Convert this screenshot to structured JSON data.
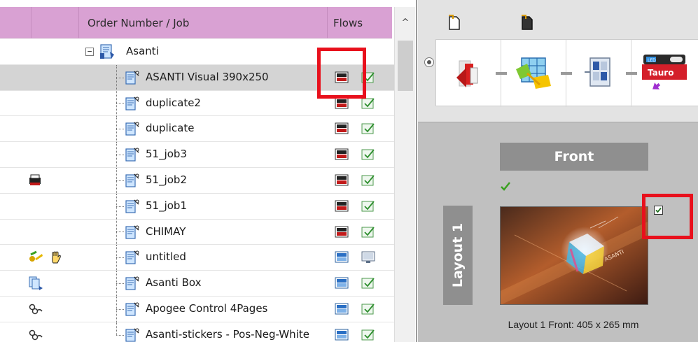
{
  "tree": {
    "columns": [
      "",
      "",
      "Order Number / Job",
      "Flows"
    ],
    "root": {
      "label": "Asanti",
      "expander": "⊟"
    },
    "rows": [
      {
        "label": "ASANTI Visual 390x250",
        "selected": true,
        "status": [],
        "flow1": "dark",
        "flow2": "check"
      },
      {
        "label": "duplicate2",
        "selected": false,
        "status": [],
        "flow1": "dark",
        "flow2": "check"
      },
      {
        "label": "duplicate",
        "selected": false,
        "status": [],
        "flow1": "dark",
        "flow2": "check"
      },
      {
        "label": "51_job3",
        "selected": false,
        "status": [],
        "flow1": "dark",
        "flow2": "check"
      },
      {
        "label": "51_job2",
        "selected": false,
        "status": [
          "printer-icon"
        ],
        "flow1": "dark",
        "flow2": "check"
      },
      {
        "label": "51_job1",
        "selected": false,
        "status": [],
        "flow1": "dark",
        "flow2": "check"
      },
      {
        "label": "CHIMAY",
        "selected": false,
        "status": [],
        "flow1": "dark",
        "flow2": "check"
      },
      {
        "label": "untitled",
        "selected": false,
        "status": [
          "key-icon",
          "hand-icon"
        ],
        "flow1": "blue",
        "flow2": "monitor"
      },
      {
        "label": "Asanti Box",
        "selected": false,
        "status": [
          "process-icon"
        ],
        "flow1": "blue",
        "flow2": "check"
      },
      {
        "label": "Apogee Control 4Pages",
        "selected": false,
        "status": [
          "link-icon"
        ],
        "flow1": "blue",
        "flow2": "check"
      },
      {
        "label": "Asanti-stickers - Pos-Neg-White",
        "selected": false,
        "status": [
          "link-icon"
        ],
        "flow1": "blue",
        "flow2": "check"
      }
    ]
  },
  "scrollbar": {
    "up_glyph": "^"
  },
  "flow": {
    "stages": [
      "input-stage-icon",
      "imposition-stage-icon",
      "layout-stage-icon",
      "tauro-printer-icon"
    ],
    "printer_badge": "Tauro",
    "printer_led": "LED"
  },
  "layout": {
    "side_label": "Front",
    "layout_tab": "Layout 1",
    "caption": "Layout 1 Front: 405 x 265 mm",
    "thumb_text": "ASANTI"
  },
  "colors": {
    "header_bg": "#d9a1d3",
    "highlight": "#e8101c",
    "selected_row": "#d4d4d4",
    "panel_bg": "#c0c0c0"
  }
}
